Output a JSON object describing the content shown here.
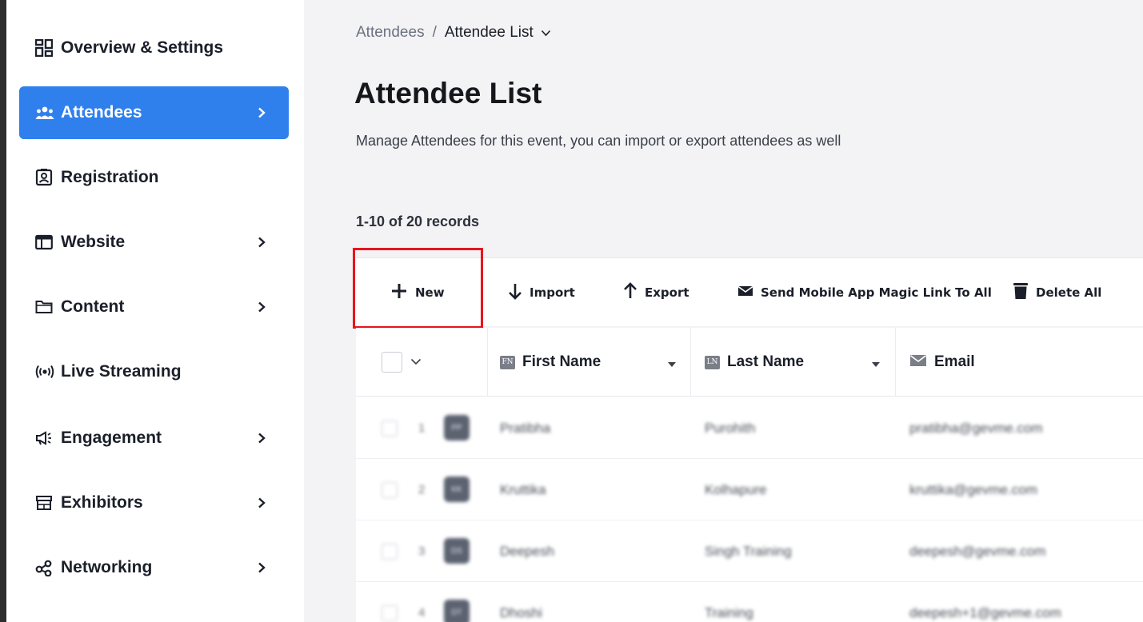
{
  "sidebar": {
    "items": [
      {
        "label": "Overview & Settings",
        "icon": "dashboard-icon",
        "has_chevron": false,
        "active": false
      },
      {
        "label": "Attendees",
        "icon": "users-icon",
        "has_chevron": true,
        "active": true
      },
      {
        "label": "Registration",
        "icon": "id-badge-icon",
        "has_chevron": false,
        "active": false
      },
      {
        "label": "Website",
        "icon": "browser-window-icon",
        "has_chevron": true,
        "active": false
      },
      {
        "label": "Content",
        "icon": "folder-icon",
        "has_chevron": true,
        "active": false
      },
      {
        "label": "Live Streaming",
        "icon": "broadcast-icon",
        "has_chevron": false,
        "active": false
      },
      {
        "label": "Engagement",
        "icon": "megaphone-icon",
        "has_chevron": true,
        "active": false
      },
      {
        "label": "Exhibitors",
        "icon": "store-icon",
        "has_chevron": true,
        "active": false
      },
      {
        "label": "Networking",
        "icon": "share-nodes-icon",
        "has_chevron": true,
        "active": false
      }
    ]
  },
  "breadcrumb": {
    "root": "Attendees",
    "separator": "/",
    "current": "Attendee List"
  },
  "header": {
    "title": "Attendee List",
    "subtitle": "Manage Attendees for this event, you can import or export attendees as well"
  },
  "records_label": "1-10 of 20 records",
  "toolbar": {
    "new_label": "New",
    "import_label": "Import",
    "export_label": "Export",
    "send_magic_link_label": "Send Mobile App Magic Link To All",
    "delete_all_label": "Delete All"
  },
  "table": {
    "columns": [
      {
        "badge": "FN",
        "label": "First Name"
      },
      {
        "badge": "LN",
        "label": "Last Name"
      },
      {
        "badge": "",
        "label": "Email"
      }
    ],
    "rows": [
      {
        "num": "1",
        "initials": "PP",
        "first": "Pratibha",
        "last": "Purohith",
        "email": "pratibha@gevme.com"
      },
      {
        "num": "2",
        "initials": "KK",
        "first": "Kruttika",
        "last": "Kolhapure",
        "email": "kruttika@gevme.com"
      },
      {
        "num": "3",
        "initials": "DS",
        "first": "Deepesh",
        "last": "Singh Training",
        "email": "deepesh@gevme.com"
      },
      {
        "num": "4",
        "initials": "DT",
        "first": "Dhoshi",
        "last": "Training",
        "email": "deepesh+1@gevme.com"
      }
    ]
  },
  "colors": {
    "accent": "#2f80ed",
    "highlight": "#e8141d",
    "main_bg": "#f3f3f5"
  }
}
